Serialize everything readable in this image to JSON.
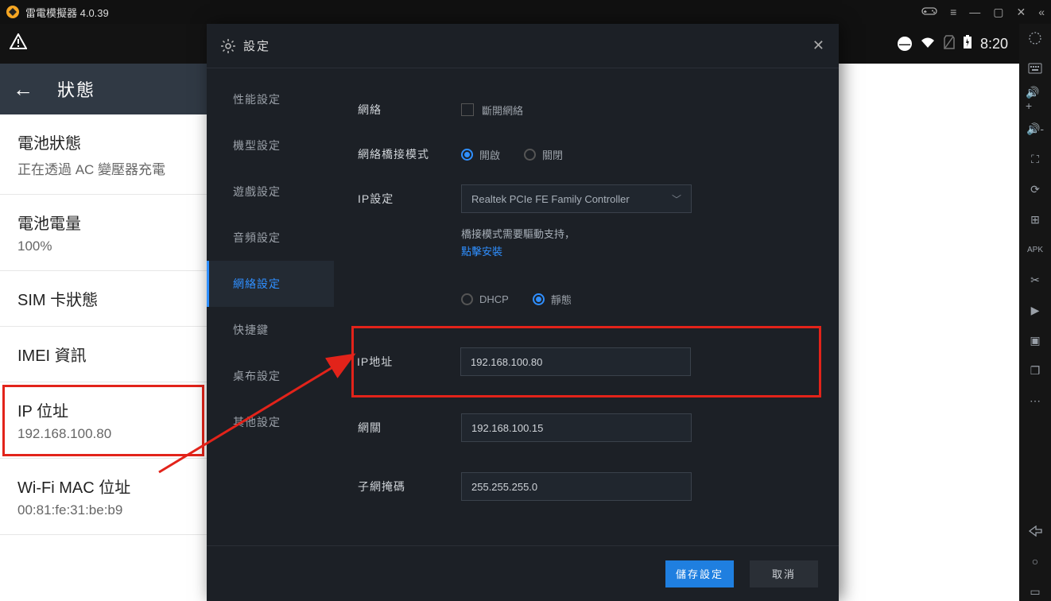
{
  "app": {
    "title": "雷電模擬器 4.0.39"
  },
  "android_status": {
    "time": "8:20"
  },
  "status_panel": {
    "header": "狀態",
    "items": [
      {
        "key": "電池狀態",
        "value": "正在透過 AC 變壓器充電"
      },
      {
        "key": "電池電量",
        "value": "100%"
      },
      {
        "key": "SIM 卡狀態",
        "value": ""
      },
      {
        "key": "IMEI 資訊",
        "value": ""
      },
      {
        "key": "IP 位址",
        "value": "192.168.100.80"
      },
      {
        "key": "Wi-Fi MAC 位址",
        "value": "00:81:fe:31:be:b9"
      }
    ]
  },
  "modal": {
    "title": "設定",
    "side": [
      "性能設定",
      "機型設定",
      "遊戲設定",
      "音頻設定",
      "網絡設定",
      "快捷鍵",
      "桌布設定",
      "其他設定"
    ],
    "active_index": 4,
    "network": {
      "section_label": "網絡",
      "disconnect_label": "斷開網絡",
      "bridge_label": "網絡橋接模式",
      "bridge_on": "開啟",
      "bridge_off": "關閉",
      "bridge_value": "on",
      "ip_setting_label": "IP設定",
      "adapter": "Realtek PCIe FE Family Controller",
      "note_line": "橋接模式需要驅動支持，",
      "note_link": "點擊安裝",
      "mode_dhcp": "DHCP",
      "mode_static": "靜態",
      "mode_value": "static",
      "ip_label": "IP地址",
      "ip_value": "192.168.100.80",
      "gw_label": "網關",
      "gw_value": "192.168.100.15",
      "mask_label": "子網掩碼",
      "mask_value": "255.255.255.0"
    },
    "save": "儲存設定",
    "cancel": "取消"
  }
}
